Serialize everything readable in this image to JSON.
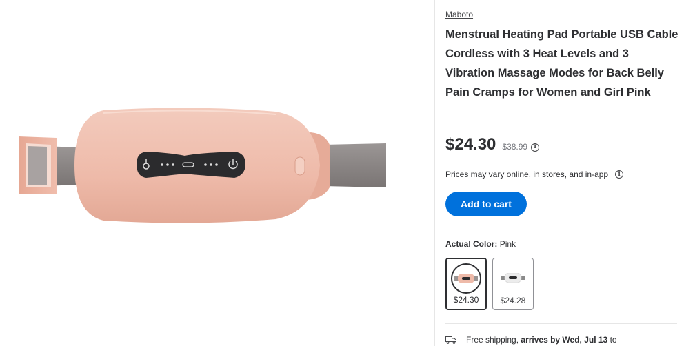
{
  "product": {
    "brand": "Maboto",
    "title": "Menstrual Heating Pad Portable USB Cable Cordless with 3 Heat Levels and 3 Vibration Massage Modes for Back Belly Pain Cramps for Women and Girl Pink",
    "price": "$24.30",
    "was_price": "$38.99",
    "info_glyph": "i",
    "price_disclaimer": "Prices may vary online, in stores, and in-app",
    "add_to_cart_label": "Add to cart",
    "color_label": "Actual Color:",
    "color_value": "Pink",
    "variants": [
      {
        "price": "$24.30",
        "color": "#e7b5a5",
        "selected": true
      },
      {
        "price": "$24.28",
        "color": "#ededed",
        "selected": false
      }
    ],
    "shipping": {
      "prefix": "Free shipping,",
      "bold": "arrives by Wed, Jul 13",
      "suffix": "to"
    }
  },
  "colors": {
    "accent": "#0071dc",
    "pad_pink": "#f0c2b3",
    "strap_gray": "#8f8a89",
    "panel_dark": "#2b2b2d"
  },
  "icons": [
    "info-icon",
    "truck-icon",
    "power-icon",
    "usb-port-icon",
    "thermometer-icon"
  ]
}
